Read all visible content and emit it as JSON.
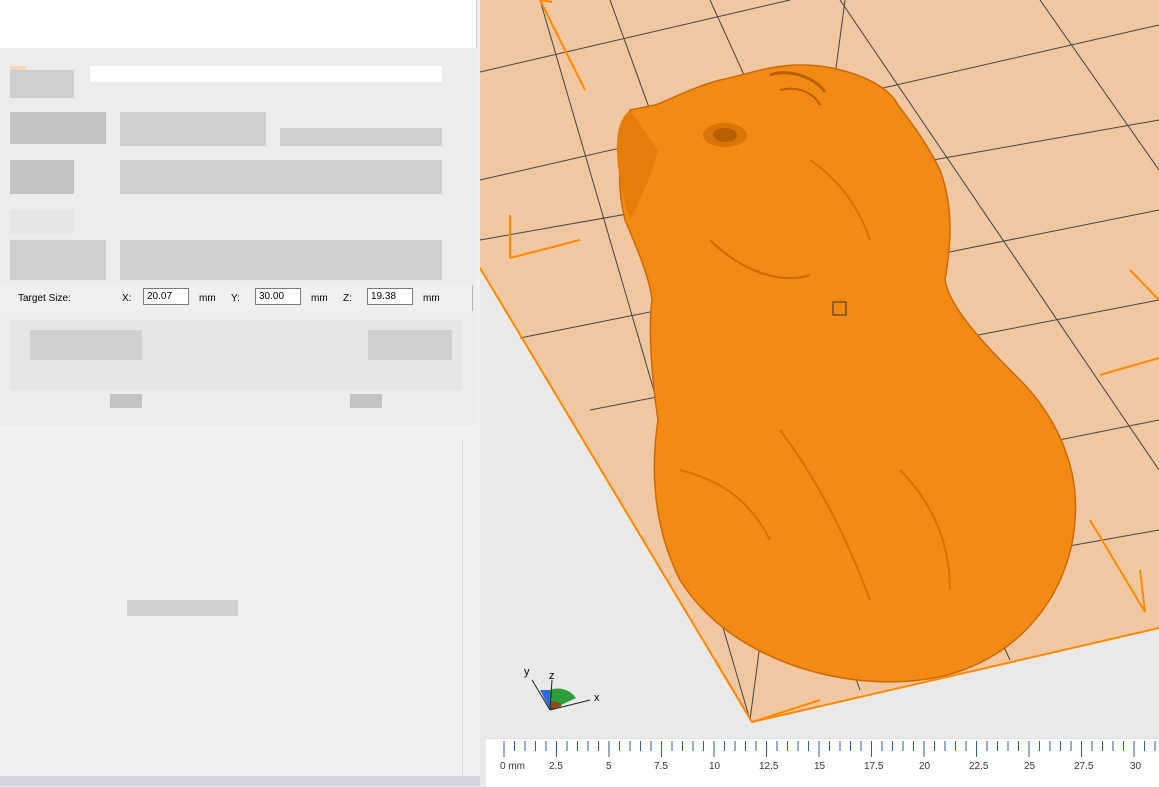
{
  "target_size": {
    "label": "Target Size:",
    "x_label": "X:",
    "x_value": "20.07",
    "y_label": "Y:",
    "y_value": "30.00",
    "z_label": "Z:",
    "z_value": "19.38",
    "unit": "mm"
  },
  "gizmo": {
    "x_label": "x",
    "y_label": "y",
    "z_label": "z"
  },
  "ruler": {
    "unit_label": "0 mm",
    "ticks": [
      "2.5",
      "5",
      "7.5",
      "10",
      "12.5",
      "15",
      "17.5",
      "20",
      "22.5",
      "25",
      "27.5",
      "30"
    ]
  },
  "colors": {
    "model": "#f28a14",
    "bed": "#f0c7a0",
    "bed_edge": "#ff8a00",
    "grid_line": "#444444",
    "panel": "#f0f0f0"
  }
}
